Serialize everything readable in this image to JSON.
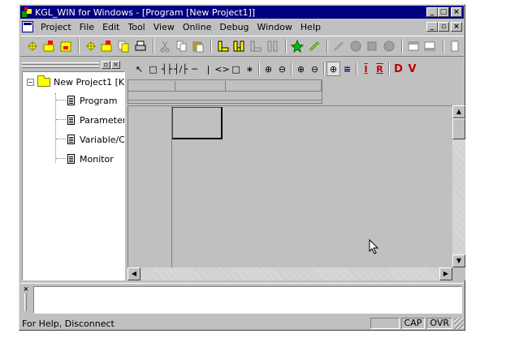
{
  "window": {
    "title": "KGL_WIN for Windows - [Program [New Project1]]",
    "caption_buttons": [
      "_",
      "□",
      "×"
    ]
  },
  "menubar": {
    "items": [
      {
        "label": "Project"
      },
      {
        "label": "File"
      },
      {
        "label": "Edit"
      },
      {
        "label": "Tool"
      },
      {
        "label": "View"
      },
      {
        "label": "Online"
      },
      {
        "label": "Debug"
      },
      {
        "label": "Window"
      },
      {
        "label": "Help"
      }
    ],
    "mdi_buttons": [
      "_",
      "▫",
      "×"
    ]
  },
  "toolbar": {
    "icons": [
      "new-project-icon",
      "open-project-icon",
      "save-project-icon",
      "new-file-icon",
      "open-file-icon",
      "copy-file-icon",
      "print-icon",
      "cut-icon",
      "copy-icon",
      "paste-icon",
      "ladder-icon-1",
      "ladder-icon-2",
      "ladder-icon-3",
      "ladder-icon-4",
      "plc-run-icon",
      "link-icon",
      "monitor-icon",
      "stop-icon",
      "download-icon",
      "upload-icon",
      "window-icon-1",
      "window-icon-2",
      "window-icon-3"
    ]
  },
  "project_tree": {
    "root": "New Project1 [K",
    "items": [
      {
        "label": "Program"
      },
      {
        "label": "Parameter"
      },
      {
        "label": "Variable/Co"
      },
      {
        "label": "Monitor"
      }
    ],
    "panel_buttons": [
      "▫",
      "×"
    ]
  },
  "ladder_toolbar": {
    "glyphs": [
      "↖",
      "□",
      "┤├",
      "┤/├",
      "─",
      "|",
      "<>",
      "□",
      "∗",
      "⊕",
      "⊖",
      "⊕",
      "⊖",
      "⊕",
      "≡",
      "I",
      "R",
      "D",
      "V"
    ]
  },
  "output_panel": {
    "close_label": "×",
    "text": ""
  },
  "statusbar": {
    "message": "For Help,  Disconnect",
    "panes": [
      "",
      "CAP",
      "OVR"
    ]
  }
}
